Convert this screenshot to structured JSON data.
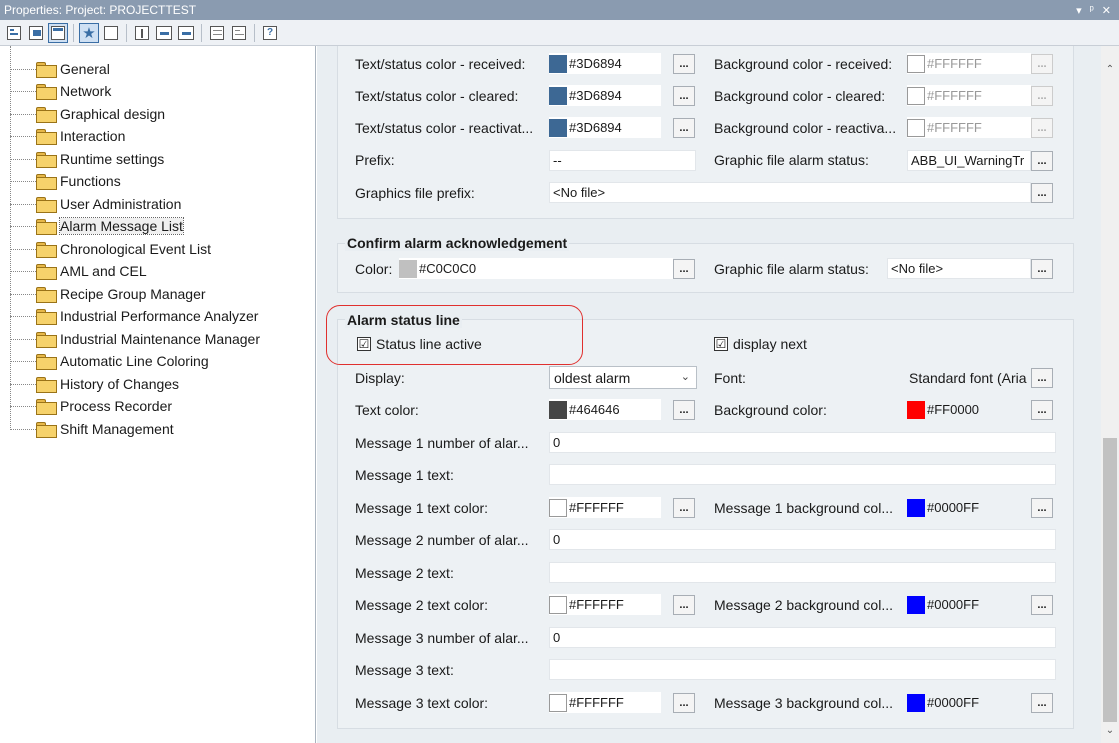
{
  "window": {
    "title": "Properties: Project: PROJECTTEST",
    "controls": [
      "▾",
      "ᵖ",
      "✕"
    ]
  },
  "toolbar": {
    "buttons": [
      "sort-categories",
      "sort-alpha",
      "property-pages",
      "favorites",
      "description",
      "show-all",
      "collapse",
      "expand",
      "filter-a",
      "filter-b",
      "help"
    ]
  },
  "tree": {
    "items": [
      {
        "label": "General"
      },
      {
        "label": "Network"
      },
      {
        "label": "Graphical design"
      },
      {
        "label": "Interaction"
      },
      {
        "label": "Runtime settings"
      },
      {
        "label": "Functions"
      },
      {
        "label": "User Administration"
      },
      {
        "label": "Alarm Message List",
        "selected": true
      },
      {
        "label": "Chronological Event List"
      },
      {
        "label": "AML and CEL"
      },
      {
        "label": "Recipe Group Manager"
      },
      {
        "label": "Industrial Performance Analyzer"
      },
      {
        "label": "Industrial Maintenance Manager"
      },
      {
        "label": "Automatic Line Coloring"
      },
      {
        "label": "History of Changes"
      },
      {
        "label": "Process Recorder"
      },
      {
        "label": "Shift Management"
      }
    ]
  },
  "top_group": {
    "rows": [
      {
        "left_label": "Text/status color - received:",
        "left_value": "#3D6894",
        "left_color": "#3D6894",
        "right_label": "Background color - received:",
        "right_value": "#FFFFFF"
      },
      {
        "left_label": "Text/status color - cleared:",
        "left_value": "#3D6894",
        "left_color": "#3D6894",
        "right_label": "Background color - cleared:",
        "right_value": "#FFFFFF"
      },
      {
        "left_label": "Text/status color - reactivat...",
        "left_value": "#3D6894",
        "left_color": "#3D6894",
        "right_label": "Background color - reactiva...",
        "right_value": "#FFFFFF"
      }
    ],
    "prefix_label": "Prefix:",
    "prefix_value": "--",
    "graphic_alarm_label": "Graphic file alarm status:",
    "graphic_alarm_value": "ABB_UI_WarningTr",
    "graphics_prefix_label": "Graphics file prefix:",
    "graphics_prefix_value": "<No file>"
  },
  "confirm_group": {
    "title": "Confirm alarm acknowledgement",
    "color_label": "Color:",
    "color_value": "#C0C0C0",
    "color_hex": "#C0C0C0",
    "graphic_label": "Graphic file alarm status:",
    "graphic_value": "<No file>"
  },
  "status_group": {
    "title": "Alarm status line",
    "status_active_label": "Status line active",
    "status_active_checked": "☑",
    "display_next_label": "display next",
    "display_next_checked": "☑",
    "display_label": "Display:",
    "display_value": "oldest alarm",
    "font_label": "Font:",
    "font_value": "Standard font (Aria",
    "text_color_label": "Text color:",
    "text_color_value": "#464646",
    "text_color_hex": "#464646",
    "bg_color_label": "Background color:",
    "bg_color_value": "#FF0000",
    "bg_color_hex": "#FF0000",
    "messages": [
      {
        "num_label": "Message 1 number of alar...",
        "num_value": "0",
        "text_label": "Message 1 text:",
        "text_value": "",
        "tc_label": "Message 1 text color:",
        "tc_value": "#FFFFFF",
        "bg_label": "Message 1 background col...",
        "bg_value": "#0000FF"
      },
      {
        "num_label": "Message 2 number of alar...",
        "num_value": "0",
        "text_label": "Message 2 text:",
        "text_value": "",
        "tc_label": "Message 2 text color:",
        "tc_value": "#FFFFFF",
        "bg_label": "Message 2 background col...",
        "bg_value": "#0000FF"
      },
      {
        "num_label": "Message 3 number of alar...",
        "num_value": "0",
        "text_label": "Message 3 text:",
        "text_value": "",
        "tc_label": "Message 3 text color:",
        "tc_value": "#FFFFFF",
        "bg_label": "Message 3 background col...",
        "bg_value": "#0000FF"
      }
    ]
  },
  "ellipsis": "..."
}
